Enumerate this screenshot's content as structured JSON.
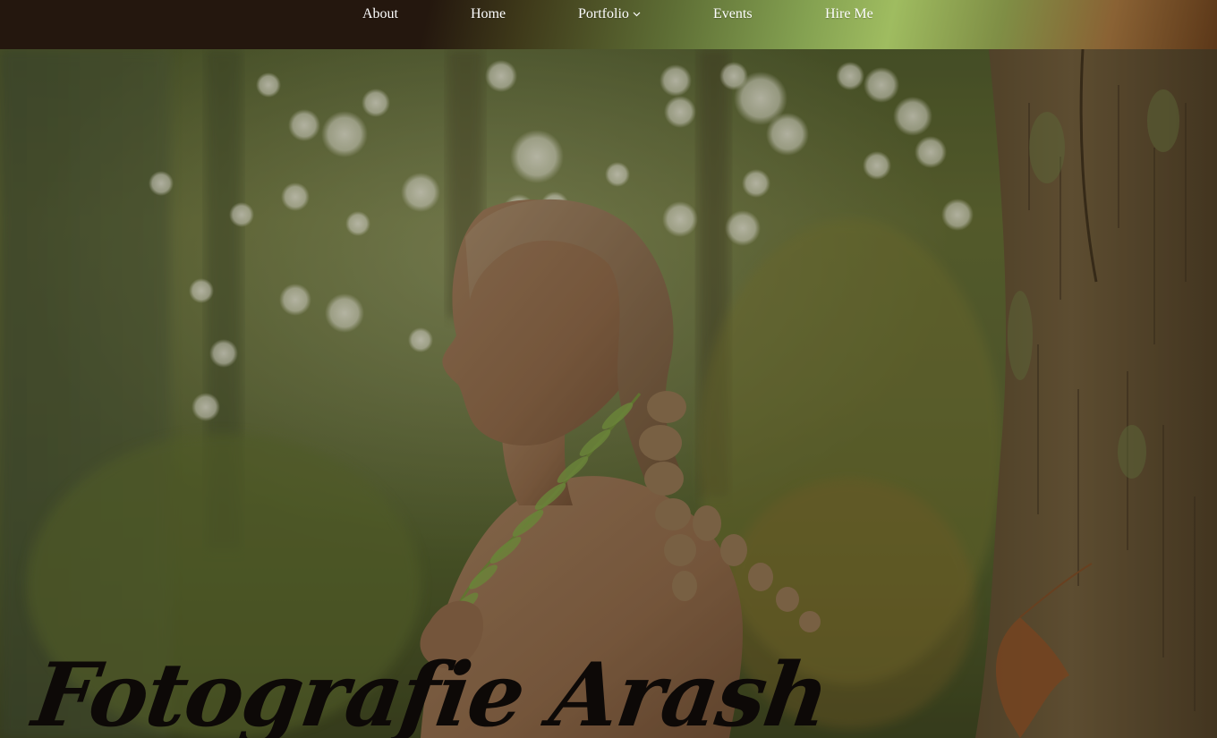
{
  "nav": {
    "items": [
      {
        "label": "About"
      },
      {
        "label": "Home"
      },
      {
        "label": "Portfolio",
        "has_dropdown": true,
        "icon": "chevron-down-icon"
      },
      {
        "label": "Events"
      },
      {
        "label": "Hire Me"
      }
    ]
  },
  "hero": {
    "title": "Fotografie Arash",
    "image_description": "Woman with braided hair holding a fern in a sunlit forest"
  },
  "colors": {
    "nav_text": "#ffffff",
    "nav_bg_dark": "#24170e",
    "nav_bg_accent": "#9fbc60",
    "title_text": "#0d0907"
  }
}
